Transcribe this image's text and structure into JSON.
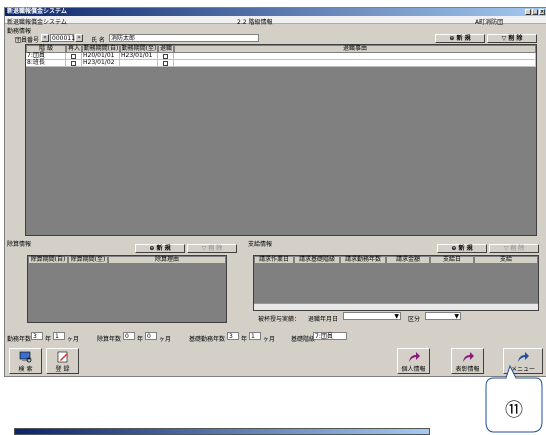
{
  "window": {
    "title": "新退職報償金システム"
  },
  "header": {
    "app": "新退職報償金システム",
    "screen": "2.2 階級情報",
    "org": "A町消防団"
  },
  "duty": {
    "section": "勤務情報",
    "member_no_label": "団員番号",
    "member_no": "000011",
    "name_label": "氏 名",
    "name": "消防太郎",
    "btn_new": "新 規",
    "btn_delete": "削 除",
    "columns": [
      "階 級",
      "再入",
      "勤務期間(自)",
      "勤務期間(至)",
      "退職",
      "退職事由"
    ],
    "rows": [
      {
        "rank": "7:団員",
        "start": "H20/01/01",
        "end": "H23/01/01"
      },
      {
        "rank": "8:班長",
        "start": "H23/01/02",
        "end": ""
      }
    ]
  },
  "exclusion": {
    "section": "除算情報",
    "btn_new": "新 規",
    "btn_delete": "削 除",
    "columns": [
      "除算期間(自)",
      "除算期間(至)",
      "除算理由"
    ]
  },
  "payment": {
    "section": "支給情報",
    "btn_new": "新 規",
    "btn_delete": "削 除",
    "columns": [
      "請求作業日",
      "請求基礎階級",
      "請求勤務年数",
      "請求金額",
      "支給日",
      "支給"
    ],
    "record_label": "被杯授与実績：",
    "retire_ym_label": "退職年月日",
    "class_label": "区分"
  },
  "totals": {
    "work_years_label": "勤務年数",
    "work_y": "3",
    "year_unit": "年",
    "work_m": "1",
    "month_unit": "ヶ月",
    "excl_label": "除算年数",
    "excl_y": "0",
    "excl_m": "0",
    "base_label": "基礎勤務年数",
    "base_y": "3",
    "base_m": "1",
    "base_rank_label": "基礎階級",
    "base_rank": "7:団員"
  },
  "actions": {
    "search": "検 索",
    "register": "登 録",
    "personal": "個人情報",
    "commend": "表彰情報",
    "menu": "メニュー"
  },
  "callout": {
    "number": "⑪"
  },
  "colors": {
    "title_bar": "#0a246a",
    "face": "#d4d0c8",
    "arrow": "#8b1a7a",
    "arrow2": "#1e4fa0"
  }
}
